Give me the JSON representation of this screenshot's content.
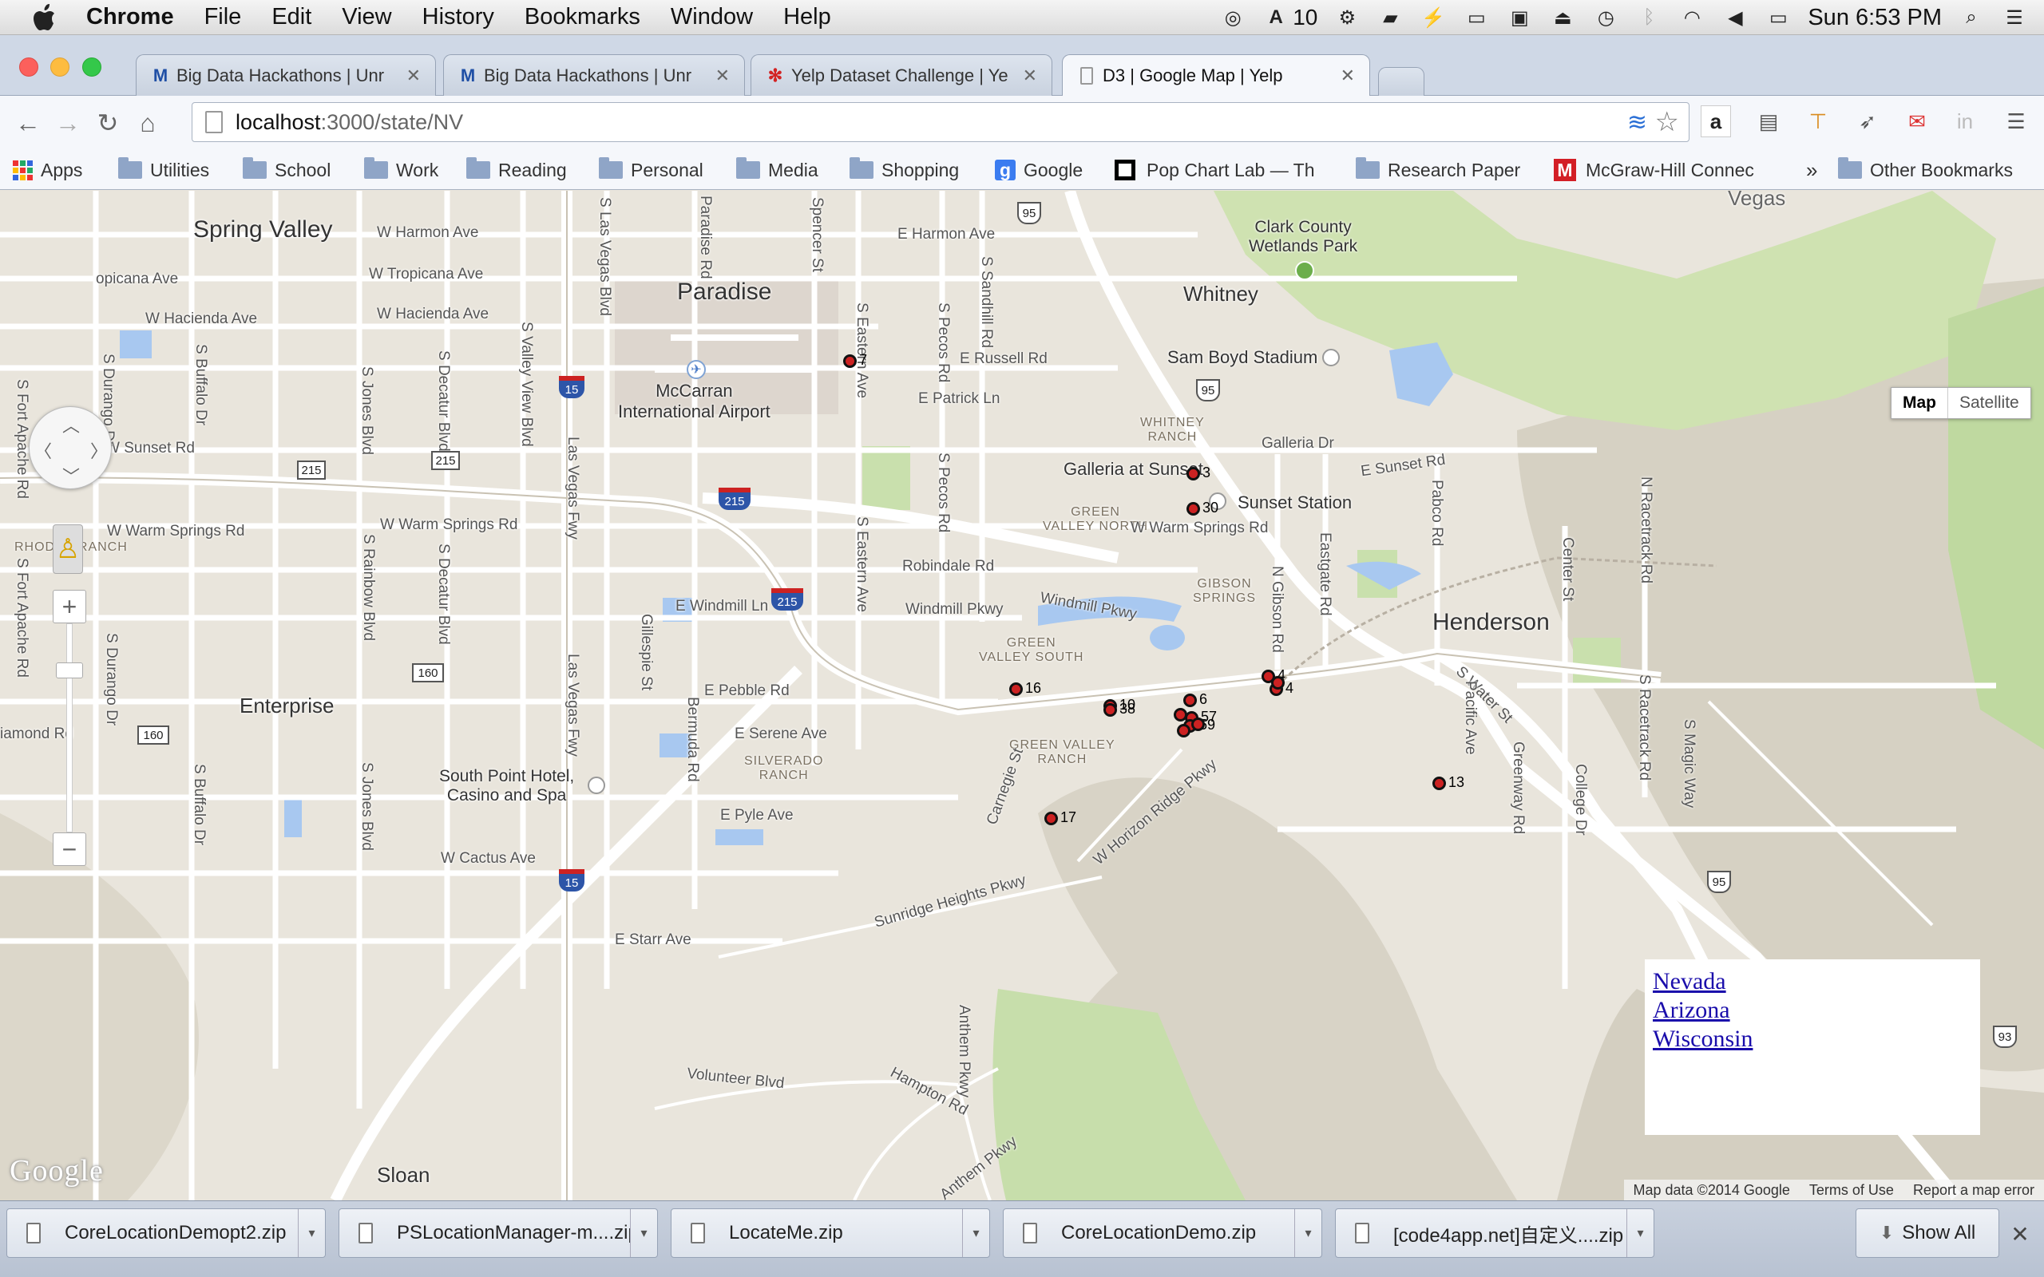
{
  "menubar": {
    "app": "Chrome",
    "items": [
      "File",
      "Edit",
      "View",
      "History",
      "Bookmarks",
      "Window",
      "Help"
    ],
    "battery_count": "10",
    "clock": "Sun 6:53 PM"
  },
  "tabs": [
    {
      "favicon": "M",
      "title": "Big Data Hackathons | Unr",
      "favicon_color": "#1f4fa5"
    },
    {
      "favicon": "M",
      "title": "Big Data Hackathons | Unr",
      "favicon_color": "#1f4fa5"
    },
    {
      "favicon": "✻",
      "title": "Yelp Dataset Challenge | Ye",
      "favicon_color": "#d32323"
    },
    {
      "favicon": "",
      "title": "D3 | Google Map | Yelp",
      "favicon_color": "#888888"
    }
  ],
  "address": {
    "host": "localhost",
    "path": ":3000/state/NV"
  },
  "bookmarks": [
    {
      "label": "Apps",
      "type": "apps"
    },
    {
      "label": "Utilities",
      "type": "folder"
    },
    {
      "label": "School",
      "type": "folder"
    },
    {
      "label": "Work",
      "type": "folder"
    },
    {
      "label": "Reading",
      "type": "folder"
    },
    {
      "label": "Personal",
      "type": "folder"
    },
    {
      "label": "Media",
      "type": "folder"
    },
    {
      "label": "Shopping",
      "type": "folder"
    },
    {
      "label": "Google",
      "type": "google"
    },
    {
      "label": "Pop Chart Lab — Th",
      "type": "site"
    },
    {
      "label": "Research Paper",
      "type": "folder"
    },
    {
      "label": "McGraw-Hill Connec",
      "type": "mcgraw"
    },
    {
      "label": "»",
      "type": "more"
    },
    {
      "label": "Other Bookmarks",
      "type": "folder"
    }
  ],
  "map": {
    "cities": [
      "Spring Valley",
      "Paradise",
      "Whitney",
      "Henderson",
      "Enterprise",
      "Sloan",
      "Vegas"
    ],
    "places": [
      "McCarran\nInternational Airport",
      "Sam Boyd Stadium",
      "Galleria at Sunset",
      "Sunset Station",
      "Clark County\nWetlands Park",
      "South Point Hotel,\nCasino and Spa"
    ],
    "areas": [
      "WHITNEY\nRANCH",
      "GREEN\nVALLEY NORTH",
      "GIBSON\nSPRINGS",
      "GREEN\nVALLEY SOUTH",
      "GREEN VALLEY\nRANCH",
      "SILVERADO\nRANCH",
      "RHODES RANCH"
    ],
    "streets": [
      "W Harmon Ave",
      "E Harmon Ave",
      "W Tropicana Ave",
      "opicana Ave",
      "W Hacienda Ave",
      "W Hacienda Ave",
      "E Russell Rd",
      "E Patrick Ln",
      "W Sunset Rd",
      "E Sunset Rd",
      "Galleria Dr",
      "W Warm Springs Rd",
      "W Warm Springs Rd",
      "W Warm Springs Rd",
      "Robindale Rd",
      "E Windmill Ln",
      "Windmill Pkwy",
      "Windmill Pkwy",
      "E Pebble Rd",
      "E Serene Ave",
      "iamond Rd",
      "E Pyle Ave",
      "W Cactus Ave",
      "E Starr Ave",
      "Sunridge Heights Pkwy",
      "W Horizon Ridge Pkwy",
      "Volunteer Blvd",
      "Hampton Rd",
      "Anthem Pkwy",
      "S Las Vegas Blvd",
      "Paradise Rd",
      "Spencer St",
      "S Eastern Ave",
      "S Sandhill Rd",
      "S Pecos Rd",
      "S Pecos Rd",
      "S Eastern Ave",
      "Las Vegas Fwy",
      "Las Vegas Fwy",
      "S Durango Dr",
      "S Buffalo Dr",
      "S Jones Blvd",
      "S Decatur Blvd",
      "S Valley View Blvd",
      "S Fort Apache Rd",
      "S Fort Apache Rd",
      "Gillespie St",
      "Bermuda Rd",
      "Carnegie St",
      "N Gibson Rd",
      "Eastgate Rd",
      "Pabco Rd",
      "Center St",
      "N Racetrack Rd",
      "S Water St",
      "Pacific Ave",
      "Greenway Rd",
      "College Dr",
      "S Racetrack Rd",
      "S Magic Way",
      "Anthem Pkwy",
      "S Rainbow Blvd",
      "S Jones Blvd",
      "S Buffalo Dr",
      "S Decatur Blvd",
      "S Durango Dr"
    ],
    "shields": [
      "95",
      "15",
      "215",
      "215",
      "215",
      "215",
      "160",
      "160",
      "15",
      "95",
      "95",
      "93"
    ],
    "markers": [
      {
        "label": "7"
      },
      {
        "label": "3"
      },
      {
        "label": "30"
      },
      {
        "label": "16"
      },
      {
        "label": "6"
      },
      {
        "label": "10"
      },
      {
        "label": "38"
      },
      {
        "label": "57"
      },
      {
        "label": "59"
      },
      {
        "label": "4"
      },
      {
        "label": "4"
      },
      {
        "label": "13"
      },
      {
        "label": "17"
      }
    ]
  },
  "map_controls": {
    "map_label": "Map",
    "satellite_label": "Satellite",
    "zoom_in": "+",
    "zoom_out": "−"
  },
  "state_links": [
    "Nevada",
    "Arizona",
    "Wisconsin"
  ],
  "attribution": {
    "logo": "Google",
    "data": "Map data ©2014 Google",
    "terms": "Terms of Use",
    "report": "Report a map error"
  },
  "downloads": [
    "CoreLocationDemopt2.zip",
    "PSLocationManager-m....zip",
    "LocateMe.zip",
    "CoreLocationDemo.zip",
    "[code4app.net]自定义....zip"
  ],
  "downloads_show_all": "Show All",
  "colors": {
    "link": "#1a0dab",
    "marker_fill": "#cc2222",
    "park": "#c5dfa5",
    "water": "#a3c4f2",
    "highway": "#ffffff"
  }
}
